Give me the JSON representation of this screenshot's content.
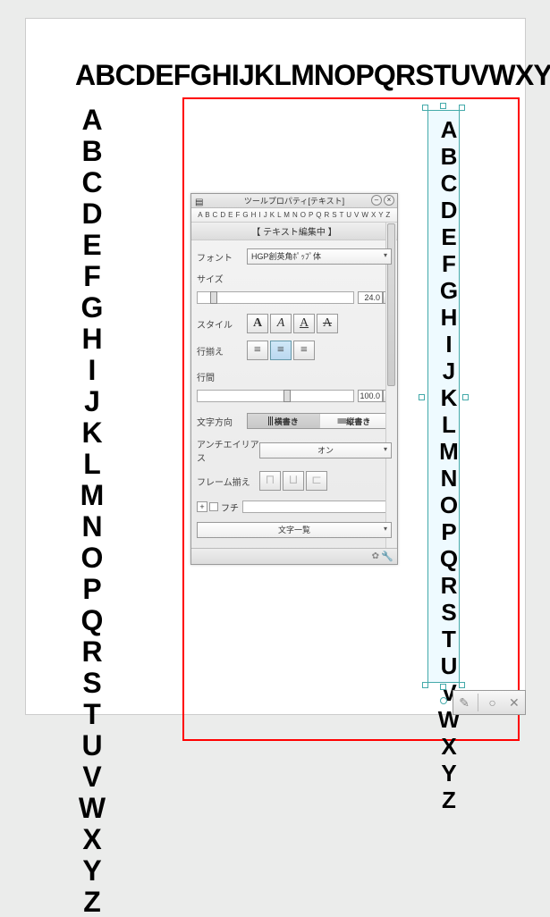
{
  "horizontal_text": "ABCDEFGHIJKLMNOPQRSTUVWXYZ",
  "vertical_text": "ABCDEFGHIJKLMNOPQRSTUVWXYZ",
  "selected_text": "ABCDEFGHIJKLMNOPQRSTUVWXYZ",
  "panel": {
    "title": "ツールプロパティ[テキスト]",
    "sample": "A B C D E F G H I J K L M N O P Q R S T U V W X Y Z",
    "editing": "【 テキスト編集中 】",
    "font_label": "フォント",
    "font_value": "HGP創英角ﾎﾟｯﾌﾟ体",
    "size_label": "サイズ",
    "size_value": "24.0",
    "style_label": "スタイル",
    "align_label": "行揃え",
    "spacing_label": "行間",
    "spacing_value": "100.0",
    "direction_label": "文字方向",
    "dir_horizontal": "横書き",
    "dir_vertical": "縦書き",
    "antialias_label": "アンチエイリアス",
    "antialias_value": "オン",
    "frame_label": "フレーム揃え",
    "edge_label": "フチ",
    "charlist": "文字一覧"
  },
  "toolbar": {
    "confirm": "○",
    "cancel": "✕",
    "pen": "✎"
  }
}
